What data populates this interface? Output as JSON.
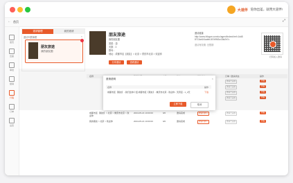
{
  "colors": {
    "accent": "#e85a2a",
    "close": "#ff5f57",
    "minimize": "#febc2e",
    "maximize": "#28c840"
  },
  "brand": {
    "name": "大道伴",
    "slogan": "陪你出差，就用大道伴!"
  },
  "appbar": {
    "label": "首页"
  },
  "sidebar": {
    "items": [
      {
        "label": "首页",
        "icon": "home-icon"
      },
      {
        "label": "出差",
        "icon": "briefcase-icon"
      },
      {
        "label": "审批",
        "icon": "clipboard-icon"
      },
      {
        "label": "报销",
        "icon": "receipt-icon"
      },
      {
        "label": "行程",
        "icon": "route-icon"
      },
      {
        "label": "订单",
        "icon": "list-icon"
      },
      {
        "label": "设置",
        "icon": "gear-icon"
      }
    ]
  },
  "panel": {
    "tabs": [
      "邀请管理",
      "我的邀请"
    ],
    "title": "邀请列表管理",
    "card": {
      "title": "朋友旅途",
      "subtitle": "我的朋友圈"
    }
  },
  "detail": {
    "title": "朋友旅途",
    "subtitle": "我的朋友圈",
    "lines": [
      "类型：游",
      "天数：3",
      "群号：",
      "地址：成都市区【朋友】> 北京 > 重庆市北京 > 欢迎你"
    ],
    "buttons": [
      "分享邀请",
      "查看邀请"
    ],
    "url_label": "邀请链接",
    "url_text": "http://www.hllvgan.com/uc/agent/index#/ref=1dd88713ab1f4adeb187d9f63c43fa2b7c",
    "url_extra": "邀请有效期: 无限期",
    "qr_label": "扫码加入邀请"
  },
  "table": {
    "headers": [
      "名称",
      "邀请时间",
      "人数",
      "状态",
      "操作状态",
      "订单 / 邀请状态",
      "操作"
    ],
    "rows": [
      {
        "name": "...",
        "time": "",
        "count": "",
        "status": "",
        "tag1": "邀请待参与",
        "tag2": "邀请已完成",
        "action": "查看"
      },
      {
        "name": "...",
        "time": "",
        "count": "",
        "status": "",
        "tag1": "邀请待参与",
        "tag2": "邀请已完成",
        "action": "查看"
      },
      {
        "name": "...",
        "time": "",
        "count": "",
        "status": "",
        "tag1": "邀请待参与",
        "tag2": "邀请已完成",
        "action": "查看"
      },
      {
        "name": "...",
        "time": "",
        "count": "",
        "status": "",
        "tag1": "邀请待参与",
        "tag2": "邀请已完成",
        "action": "查看"
      },
      {
        "name": "成都市区【朋友】> 北京 > 重庆市北京 > 欢迎你",
        "time": "2024-05-21 10:00:00",
        "count": "9/0",
        "status": "邀请完成",
        "tag1": "邀请待参与",
        "tag2": "邀请已完成",
        "action": "查看"
      },
      {
        "name": "我的朋友 > 北京 > 欢迎你",
        "time": "2024-05-21 10:00:00",
        "count": "9/0",
        "status": "邀请完成",
        "tag1": "邀请待参与",
        "tag2": "邀请已完成",
        "action": "查看"
      }
    ]
  },
  "dialog": {
    "title": "邀请说明",
    "head": {
      "name": "名称",
      "op": "操作"
    },
    "row": {
      "name": "成都市区【朋友】- 我们给你介绍 成都市区【朋友】- 重庆市北京 - 欢迎你 - 天府店 - 1_2天",
      "op": "下载"
    },
    "ok": "立即下载",
    "cancel": "取消"
  }
}
